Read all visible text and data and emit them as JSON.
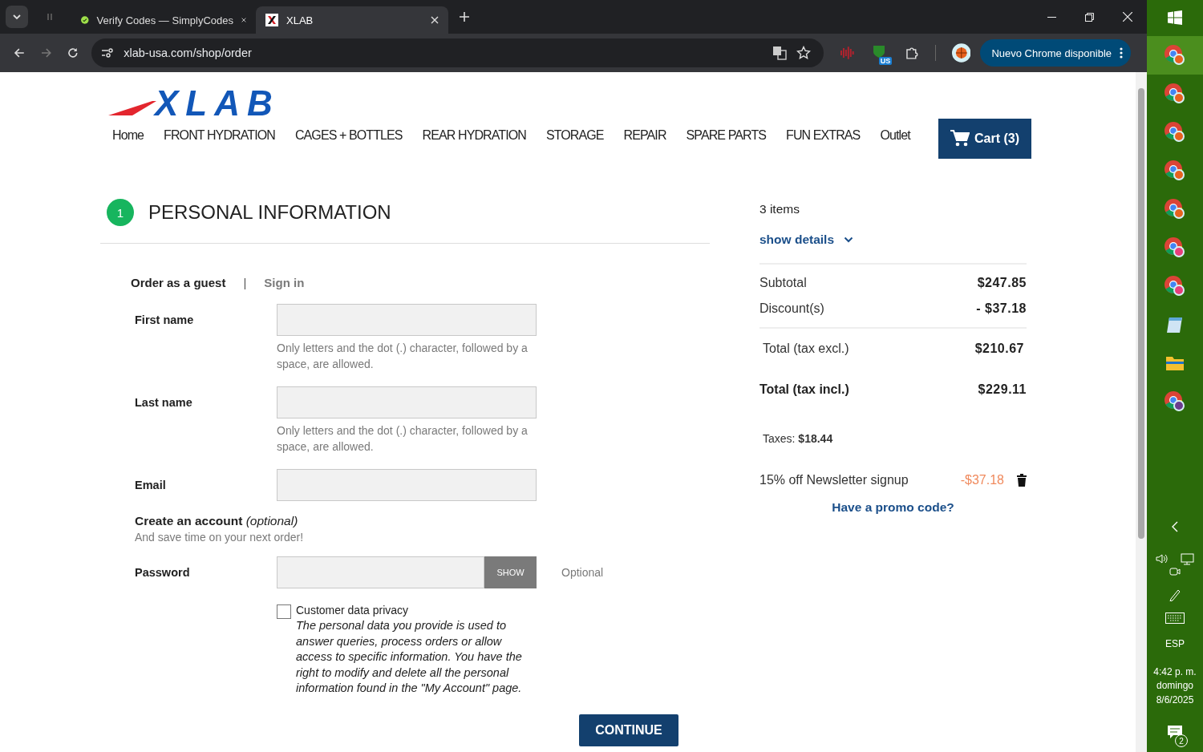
{
  "browser": {
    "tabs": [
      {
        "title": "Verify Codes — SimplyCodes",
        "selected": false
      },
      {
        "title": "XLAB",
        "selected": true
      }
    ],
    "url": "xlab-usa.com/shop/order",
    "extension_badge": "US",
    "update_button": "Nuevo Chrome disponible"
  },
  "site": {
    "logo": "XLAB",
    "nav": [
      "Home",
      "FRONT HYDRATION",
      "CAGES + BOTTLES",
      "REAR HYDRATION",
      "STORAGE",
      "REPAIR",
      "SPARE PARTS",
      "FUN EXTRAS",
      "Outlet"
    ],
    "cart": "Cart (3)"
  },
  "step": {
    "number": "1",
    "title": "PERSONAL INFORMATION"
  },
  "login_tabs": [
    {
      "label": "Order as a guest",
      "selected": true
    },
    {
      "label": "Sign in",
      "selected": false
    }
  ],
  "login_separator": "|",
  "fields": [
    {
      "label": "First name",
      "hint": "Only letters and the dot (.) character, followed by a space, are allowed."
    },
    {
      "label": "Last name",
      "hint": "Only letters and the dot (.) character, followed by a space, are allowed."
    },
    {
      "label": "Email"
    }
  ],
  "account": {
    "title": "**Create an account** *(optional)*",
    "subtitle": "And save time on your next order!"
  },
  "password": {
    "label": "Password",
    "button": "SHOW",
    "note": "Optional"
  },
  "privacy": {
    "label": "Customer data privacy",
    "checked": false,
    "text": "The personal data you provide is used to answer queries, process orders or allow access to specific information. You have the right to modify and delete all the personal information found in the \"My Account\" page."
  },
  "continue": "CONTINUE",
  "summary": {
    "items": "3 items",
    "details": "show details",
    "lines": [
      {
        "label": "Subtotal",
        "value": "$247.85"
      },
      {
        "label": "Discount(s)",
        "value": "- $37.18"
      }
    ],
    "total_excl": {
      "label": "Total (tax excl.)",
      "value": "$210.67"
    },
    "total_incl": {
      "label": "Total (tax incl.)",
      "value": "$229.11"
    },
    "taxes": "Taxes: **$18.44**",
    "voucher": {
      "name": "15% off Newsletter signup",
      "value": "-$37.18"
    },
    "promo": "Have a promo code?"
  },
  "taskbar": {
    "apps": [
      {
        "kind": "chrome",
        "selected": true
      },
      {
        "kind": "chrome",
        "selected": false
      },
      {
        "kind": "chrome",
        "selected": false
      },
      {
        "kind": "chrome",
        "selected": false
      },
      {
        "kind": "chrome",
        "selected": false
      },
      {
        "kind": "chrome-pink",
        "selected": false
      },
      {
        "kind": "chrome-pink",
        "selected": false
      },
      {
        "kind": "notepad",
        "selected": false
      },
      {
        "kind": "folder",
        "selected": false
      },
      {
        "kind": "chrome-lock",
        "selected": false
      }
    ],
    "language": "ESP",
    "time": "4:42 p. m.",
    "day": "domingo",
    "date": "8/6/2025",
    "notifications": "2"
  }
}
